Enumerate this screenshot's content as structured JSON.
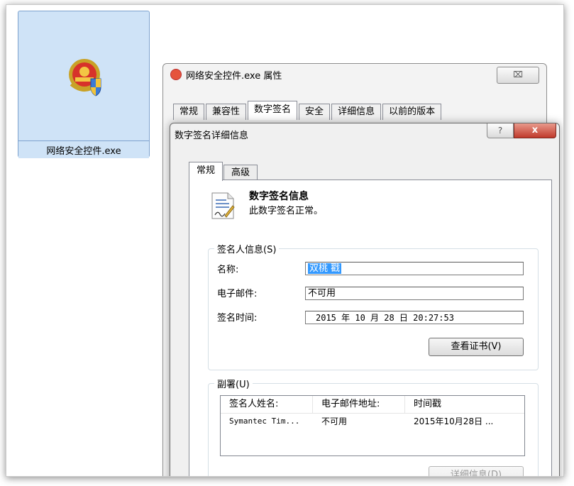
{
  "desktop_file": {
    "name": "网络安全控件.exe",
    "icon": "police-emblem-shield-icon"
  },
  "properties_window": {
    "title": "网络安全控件.exe 属性",
    "close_glyph": "⌧",
    "tabs": [
      "常规",
      "兼容性",
      "数字签名",
      "安全",
      "详细信息",
      "以前的版本"
    ],
    "active_tab": "数字签名"
  },
  "dialog": {
    "title": "数字签名详细信息",
    "help_glyph": "?",
    "close_glyph": "x",
    "tabs": [
      "常规",
      "高级"
    ],
    "active_tab": "常规",
    "signature_info": {
      "heading": "数字签名信息",
      "status": "此数字签名正常。"
    },
    "signer_group": {
      "legend": "签名人信息(S)",
      "name_label": "名称:",
      "name_value": "双桃 戳",
      "email_label": "电子邮件:",
      "email_value": "不可用",
      "time_label": "签名时间:",
      "time_value": "2015  年  10  月  28  日 20:27:53",
      "view_cert_button": "查看证书(V)"
    },
    "countersign_group": {
      "legend": "副署(U)",
      "columns": [
        "签名人姓名:",
        "电子邮件地址:",
        "时间戳"
      ],
      "rows": [
        [
          "Symantec Tim...",
          "不可用",
          "2015年10月28日 ..."
        ]
      ],
      "details_button": "详细信息(D)"
    }
  }
}
